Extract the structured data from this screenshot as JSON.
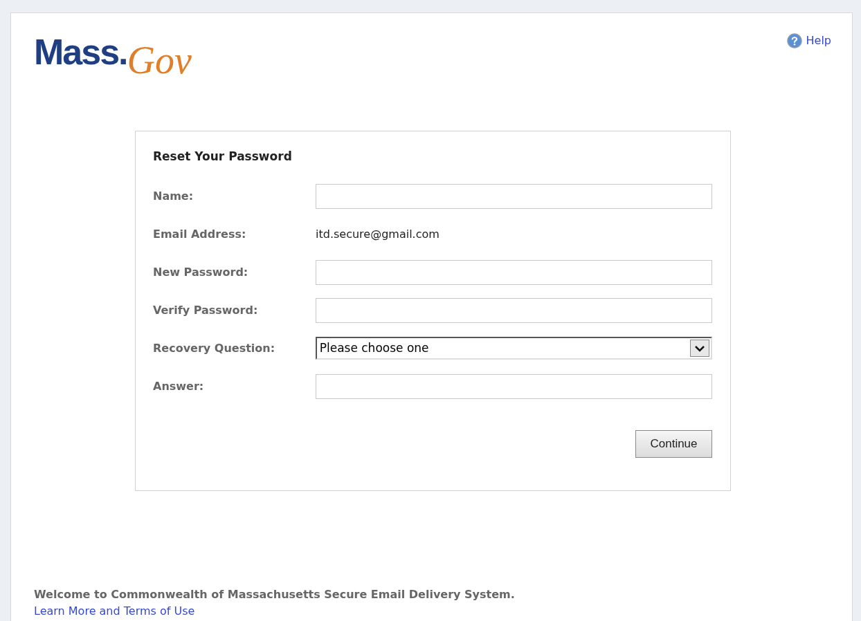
{
  "logo": {
    "part_1": "Mass.",
    "part_2": "Gov"
  },
  "help": {
    "label": "Help"
  },
  "form": {
    "title": "Reset Your Password",
    "fields": [
      {
        "kind": "input",
        "label": "Name:"
      },
      {
        "kind": "text",
        "label": "Email Address:",
        "value": "itd.secure@gmail.com"
      },
      {
        "kind": "input",
        "label": "New Password:"
      },
      {
        "kind": "input",
        "label": "Verify Password:"
      },
      {
        "kind": "select",
        "label": "Recovery Question:",
        "value": "Please choose one"
      },
      {
        "kind": "input",
        "label": "Answer:"
      }
    ],
    "button": "Continue"
  },
  "footer": {
    "welcome": "Welcome to Commonwealth of Massachusetts Secure Email Delivery System.",
    "link": "Learn More and Terms of Use"
  }
}
